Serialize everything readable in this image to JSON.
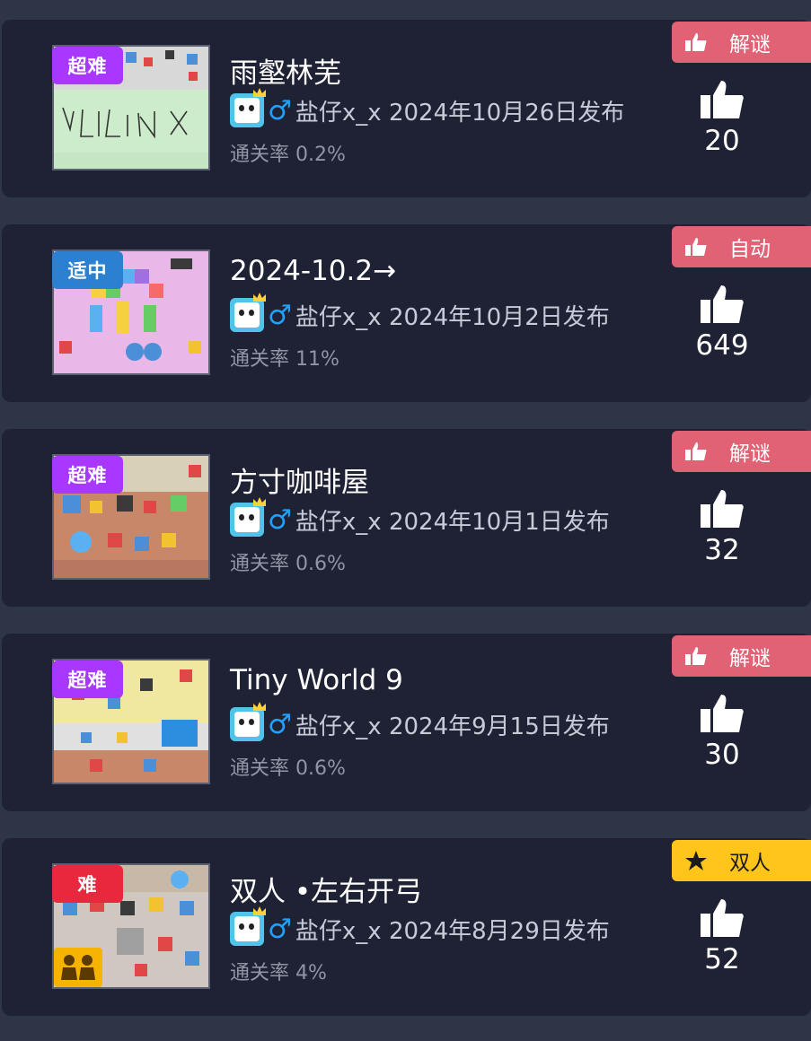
{
  "colors": {
    "page_bg": "#2d3546",
    "card_bg": "#1f2234",
    "tag_red": "#e06274",
    "tag_yellow": "#ffc51a",
    "diff_super_hard": "#a838ff",
    "diff_medium": "#2b80d2",
    "diff_hard": "#e8283c",
    "gender_blue": "#1fa2ff"
  },
  "levels": [
    {
      "title": "雨壑林芜",
      "difficulty": "超难",
      "difficulty_color": "#a838ff",
      "author_line": "盐仔x_x 2024年10月26日发布",
      "gender_symbol": "♂",
      "clear_rate": "通关率 0.2%",
      "tag": "解谜",
      "tag_icon": "thumbs-up-small-icon",
      "likes": "20",
      "thumb_theme": "green-letters"
    },
    {
      "title": "2024-10.2→",
      "difficulty": "适中",
      "difficulty_color": "#2b80d2",
      "author_line": "盐仔x_x 2024年10月2日发布",
      "gender_symbol": "♂",
      "clear_rate": "通关率 11%",
      "tag": "自动",
      "tag_icon": "thumbs-up-small-icon",
      "likes": "649",
      "thumb_theme": "pink-rainbow"
    },
    {
      "title": "方寸咖啡屋",
      "difficulty": "超难",
      "difficulty_color": "#a838ff",
      "author_line": "盐仔x_x 2024年10月1日发布",
      "gender_symbol": "♂",
      "clear_rate": "通关率 0.6%",
      "tag": "解谜",
      "tag_icon": "thumbs-up-small-icon",
      "likes": "32",
      "thumb_theme": "cafe"
    },
    {
      "title": "Tiny World 9",
      "difficulty": "超难",
      "difficulty_color": "#a838ff",
      "author_line": "盐仔x_x 2024年9月15日发布",
      "gender_symbol": "♂",
      "clear_rate": "通关率 0.6%",
      "tag": "解谜",
      "tag_icon": "thumbs-up-small-icon",
      "likes": "30",
      "thumb_theme": "yellow-world"
    },
    {
      "title": "双人 •左右开弓",
      "difficulty": "难",
      "difficulty_color": "#e8283c",
      "author_line": "盐仔x_x 2024年8月29日发布",
      "gender_symbol": "♂",
      "clear_rate": "通关率 4%",
      "tag": "双人",
      "tag_icon": "star-icon",
      "likes": "52",
      "thumb_theme": "grey-coop",
      "coop_icon": "two-players-icon"
    }
  ]
}
